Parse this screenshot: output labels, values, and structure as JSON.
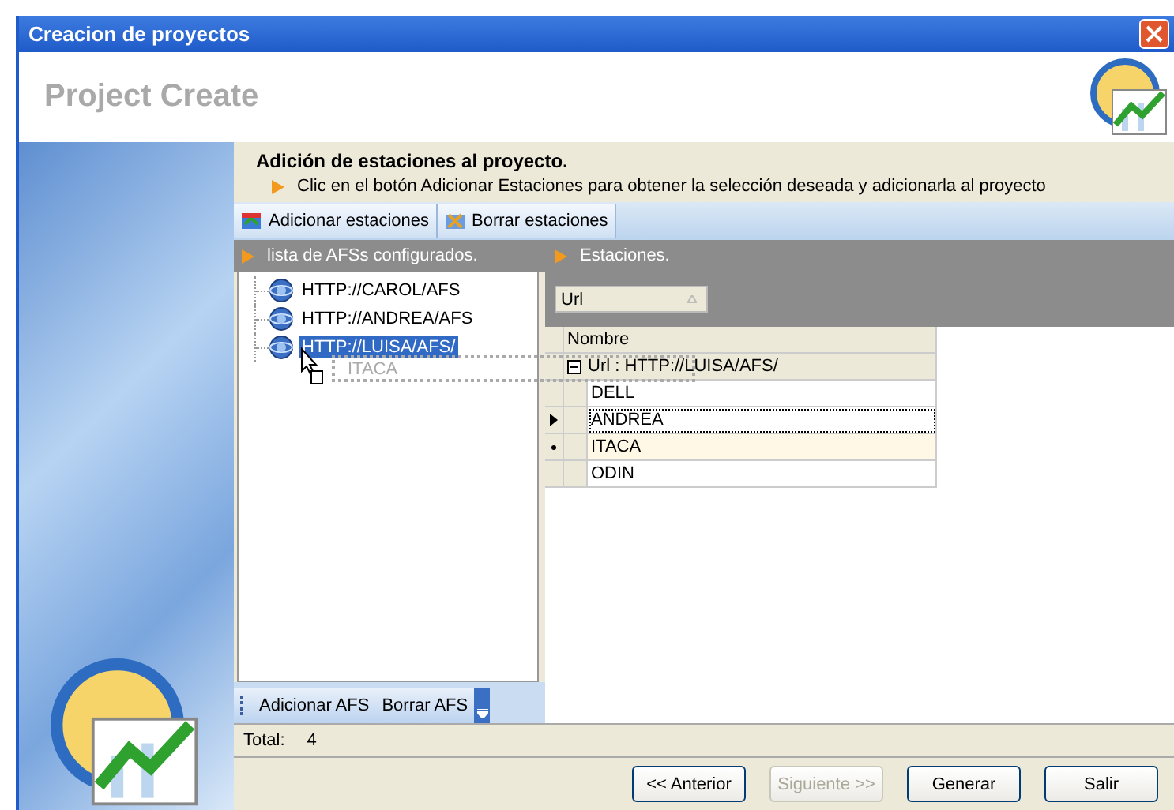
{
  "window": {
    "title": "Creacion de proyectos"
  },
  "header": {
    "title": "Project Create"
  },
  "intro": {
    "heading": "Adición de estaciones al proyecto.",
    "instruction": "Clic en el botón Adicionar Estaciones para obtener la selección deseada y adicionarla al proyecto"
  },
  "toolbar": {
    "buttons": [
      {
        "label": "Adicionar estaciones",
        "kind": "add"
      },
      {
        "label": "Borrar estaciones",
        "kind": "delete"
      }
    ]
  },
  "afs_panel": {
    "title": "lista de AFSs configurados.",
    "items": [
      {
        "label": "HTTP://CAROL/AFS",
        "selected": false
      },
      {
        "label": "HTTP://ANDREA/AFS",
        "selected": false
      },
      {
        "label": "HTTP://LUISA/AFS/",
        "selected": true
      }
    ],
    "drag_ghost": "ITACA",
    "buttons": [
      {
        "label": "Adicionar AFS"
      },
      {
        "label": "Borrar AFS"
      }
    ]
  },
  "stations_panel": {
    "title": "Estaciones.",
    "group_by": "Url",
    "columns": [
      "Nombre"
    ],
    "group": {
      "label": "Url : HTTP://LUISA/AFS/",
      "expanded": true
    },
    "rows": [
      {
        "name": "DELL",
        "current": false,
        "hot": false
      },
      {
        "name": "ANDREA",
        "current": true,
        "hot": false
      },
      {
        "name": "ITACA",
        "current": false,
        "hot": true
      },
      {
        "name": "ODIN",
        "current": false,
        "hot": false
      }
    ]
  },
  "status_bar": {
    "label": "Total:",
    "value": "4"
  },
  "buttons": [
    {
      "label": "<< Anterior",
      "disabled": false
    },
    {
      "label": "Siguiente >>",
      "disabled": true
    },
    {
      "label": "Generar",
      "disabled": false
    },
    {
      "label": "Salir",
      "disabled": false
    }
  ]
}
